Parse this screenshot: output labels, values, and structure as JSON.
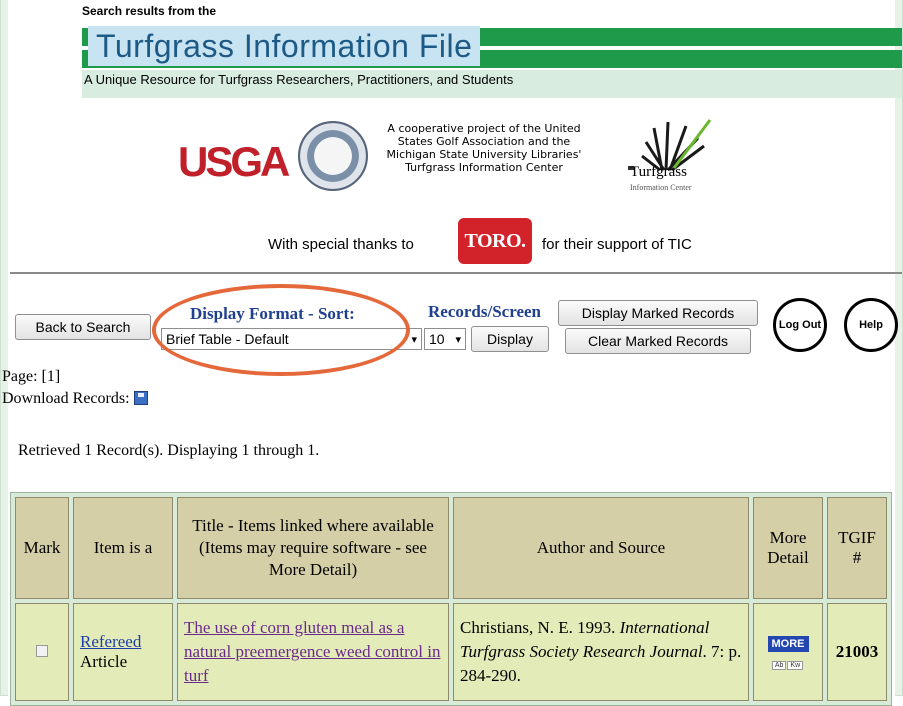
{
  "banner": {
    "caption": "Search results from the",
    "title": "Turfgrass Information File",
    "subtitle": "A Unique Resource for Turfgrass Researchers, Practitioners, and Students"
  },
  "logos": {
    "usga": "USGA",
    "coop_text": "A cooperative project of the United States Golf Association and the Michigan State University Libraries' Turfgrass Information Center",
    "turfgrass": "Turfgrass",
    "turfgrass_small": "Information Center"
  },
  "thanks": {
    "before": "With special thanks to",
    "toro": "TORO.",
    "after": "for their support of TIC"
  },
  "controls": {
    "back_button": "Back to Search",
    "format_label": "Display Format - Sort:",
    "format_value": "Brief Table - Default",
    "records_label": "Records/Screen",
    "records_value": "10",
    "display_button": "Display",
    "display_marked_button": "Display Marked Records",
    "clear_marked_button": "Clear Marked Records",
    "logout_button": "Log Out",
    "help_button": "Help"
  },
  "page": {
    "page_text": "Page: [1]",
    "download_text": "Download Records:",
    "retrieved_text": "Retrieved 1 Record(s). Displaying 1 through 1."
  },
  "table": {
    "headers": {
      "mark": "Mark",
      "item": "Item is a",
      "title": "Title - Items linked where available (Items may require software - see More Detail)",
      "author": "Author and Source",
      "more": "More Detail",
      "tgif": "TGIF #"
    },
    "rows": [
      {
        "item_link": "Refereed",
        "item_rest": "Article",
        "title": "The use of corn gluten meal as a natural preemergence weed control in turf",
        "author": "Christians, N. E. 1993.",
        "journal": "International Turfgrass Society Research Journal",
        "source_rest": ". 7: p. 284-290.",
        "more": "MORE",
        "mini_ab": "Ab",
        "mini_kw": "Kw",
        "tgif": "21003"
      }
    ]
  },
  "colors": {
    "accent_blue": "#1f3f8f",
    "banner_green": "#1f9a4a",
    "usga_red": "#c0202a",
    "toro_red": "#d2222a",
    "highlight_oval": "#e4683a"
  }
}
